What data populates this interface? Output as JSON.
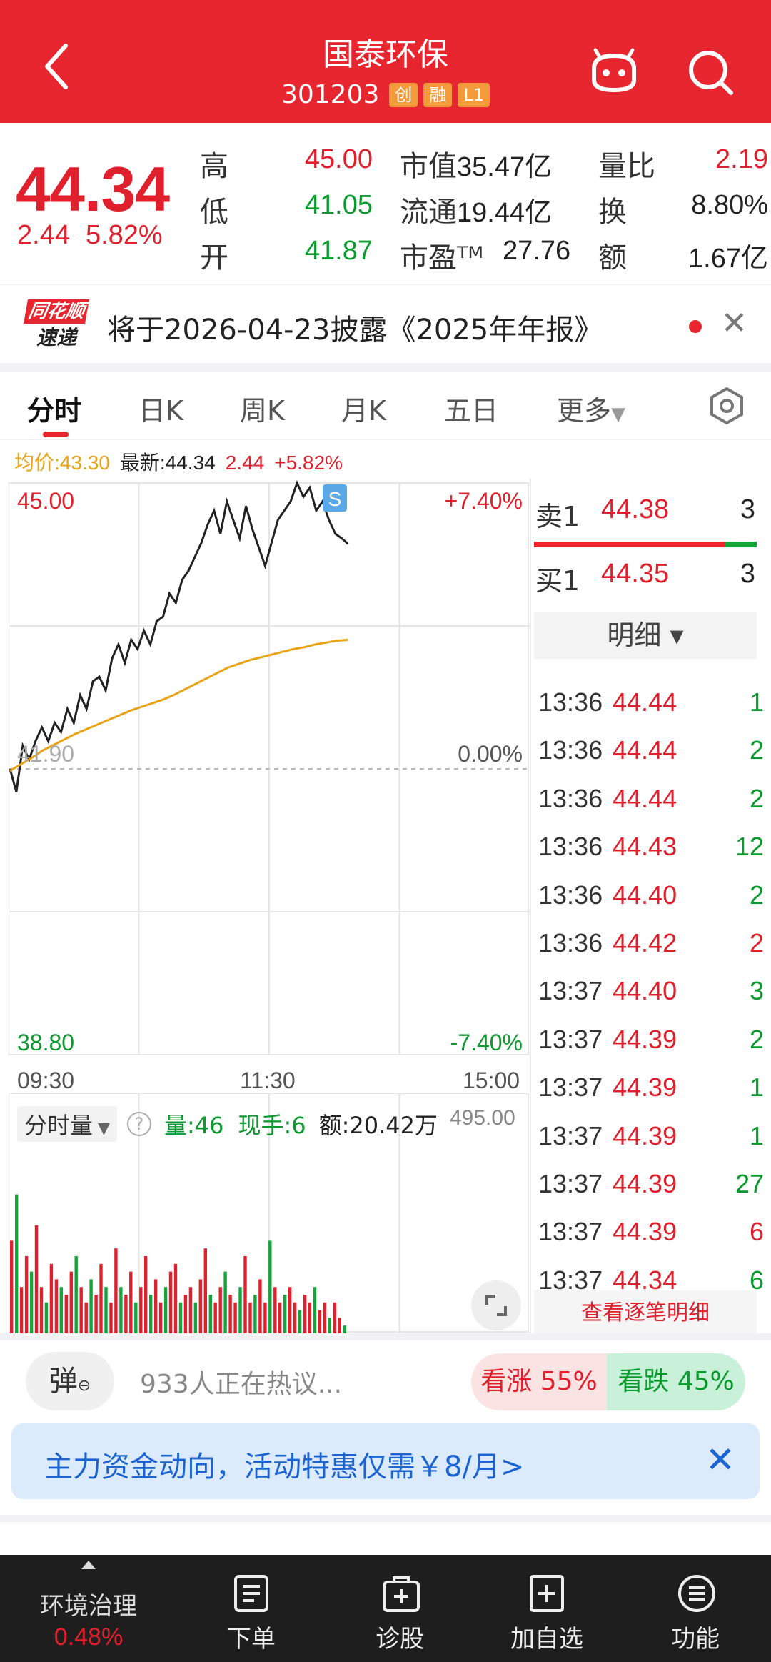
{
  "header": {
    "title": "国泰环保",
    "code": "301203",
    "tags": [
      "创",
      "融",
      "L1"
    ]
  },
  "quote": {
    "price": "44.34",
    "change": "2.44",
    "change_pct": "5.82%",
    "high_label": "高",
    "high": "45.00",
    "low_label": "低",
    "low": "41.05",
    "open_label": "开",
    "open": "41.87",
    "mktcap_label": "市值",
    "mktcap": "35.47亿",
    "float_label": "流通",
    "float": "19.44亿",
    "pe_label": "市盈ᵀᴹ",
    "pe": "27.76",
    "volratio_label": "量比",
    "volratio": "2.19",
    "turnover_label": "换",
    "turnover": "8.80%",
    "amount_label": "额",
    "amount": "1.67亿"
  },
  "notice": {
    "logo_top": "同花顺",
    "logo_bottom": "速递",
    "text": "将于2026-04-23披露《2025年年报》"
  },
  "tabs": [
    "分时",
    "日K",
    "周K",
    "月K",
    "五日",
    "更多"
  ],
  "info": {
    "avg_label": "均价:43.30",
    "latest_label": "最新:44.34",
    "change": "2.44",
    "change_pct": "+5.82%"
  },
  "chart_data": {
    "type": "line",
    "title": "",
    "xlabel": "",
    "ylabel": "",
    "x_ticks": [
      "09:30",
      "11:30",
      "15:00"
    ],
    "y_left_ticks": [
      "45.00",
      "41.90",
      "38.80"
    ],
    "y_right_ticks": [
      "+7.40%",
      "0.00%",
      "-7.40%"
    ],
    "ylim": [
      38.8,
      45.0
    ],
    "prev_close": 41.9,
    "series": [
      {
        "color": "#222222",
        "values": [
          41.9,
          41.65,
          42.15,
          42.0,
          42.2,
          42.35,
          42.2,
          42.4,
          42.3,
          42.55,
          42.4,
          42.7,
          42.55,
          42.85,
          42.9,
          42.75,
          43.1,
          43.25,
          43.05,
          43.3,
          43.2,
          43.4,
          43.25,
          43.5,
          43.55,
          43.8,
          43.7,
          43.95,
          44.05,
          44.2,
          44.35,
          44.55,
          44.7,
          44.45,
          44.8,
          44.6,
          44.4,
          44.75,
          44.5,
          44.3,
          44.1,
          44.35,
          44.6,
          44.7,
          44.8,
          45.0,
          44.85,
          44.95,
          44.7,
          44.8,
          44.6,
          44.45,
          44.4,
          44.34
        ],
        "name": ""
      },
      {
        "color": "#e8a317",
        "values": [
          41.88,
          41.95,
          42.02,
          42.1,
          42.16,
          42.22,
          42.28,
          42.33,
          42.38,
          42.43,
          42.48,
          42.53,
          42.57,
          42.61,
          42.65,
          42.7,
          42.76,
          42.82,
          42.88,
          42.94,
          43.0,
          43.04,
          43.08,
          43.11,
          43.14,
          43.17,
          43.2,
          43.22,
          43.25,
          43.27,
          43.29,
          43.3
        ],
        "name": ""
      }
    ]
  },
  "volume": {
    "selector": "分时量",
    "help": "?",
    "vol": "量:46",
    "hand": "现手:6",
    "amount": "额:20.42万",
    "max": "495.00",
    "bars": [
      0.6,
      0.9,
      0.3,
      0.5,
      0.4,
      0.7,
      0.3,
      0.2,
      0.45,
      0.35,
      0.3,
      0.25,
      0.4,
      0.5,
      0.3,
      0.2,
      0.35,
      0.25,
      0.45,
      0.3,
      0.2,
      0.55,
      0.3,
      0.25,
      0.4,
      0.2,
      0.3,
      0.5,
      0.25,
      0.35,
      0.2,
      0.3,
      0.4,
      0.45,
      0.2,
      0.25,
      0.3,
      0.2,
      0.35,
      0.55,
      0.25,
      0.2,
      0.3,
      0.4,
      0.25,
      0.2,
      0.3,
      0.5,
      0.2,
      0.25,
      0.35,
      0.2,
      0.6,
      0.3,
      0.2,
      0.25,
      0.3,
      0.2,
      0.15,
      0.25,
      0.2,
      0.3,
      0.15,
      0.2,
      0.1,
      0.2,
      0.1,
      0.05
    ]
  },
  "order_book": {
    "sell_label": "卖1",
    "sell_price": "44.38",
    "sell_vol": "3",
    "buy_label": "买1",
    "buy_price": "44.35",
    "buy_vol": "3",
    "detail_label": "明细 ▾",
    "ticks": [
      {
        "time": "13:36",
        "price": "44.44",
        "vol": "1",
        "dir": "green"
      },
      {
        "time": "13:36",
        "price": "44.44",
        "vol": "2",
        "dir": "green"
      },
      {
        "time": "13:36",
        "price": "44.44",
        "vol": "2",
        "dir": "green"
      },
      {
        "time": "13:36",
        "price": "44.43",
        "vol": "12",
        "dir": "green"
      },
      {
        "time": "13:36",
        "price": "44.40",
        "vol": "2",
        "dir": "green"
      },
      {
        "time": "13:36",
        "price": "44.42",
        "vol": "2",
        "dir": "red"
      },
      {
        "time": "13:37",
        "price": "44.40",
        "vol": "3",
        "dir": "green"
      },
      {
        "time": "13:37",
        "price": "44.39",
        "vol": "2",
        "dir": "green"
      },
      {
        "time": "13:37",
        "price": "44.39",
        "vol": "1",
        "dir": "green"
      },
      {
        "time": "13:37",
        "price": "44.39",
        "vol": "1",
        "dir": "green"
      },
      {
        "time": "13:37",
        "price": "44.39",
        "vol": "27",
        "dir": "green"
      },
      {
        "time": "13:37",
        "price": "44.39",
        "vol": "6",
        "dir": "red"
      },
      {
        "time": "13:37",
        "price": "44.34",
        "vol": "6",
        "dir": "green"
      }
    ],
    "all_ticks": "查看逐笔明细"
  },
  "discuss": {
    "danmu": "弹",
    "text": "933人正在热议...",
    "bull": "看涨 55%",
    "bear": "看跌 45%",
    "bull_pct": 55
  },
  "promo": {
    "text": "主力资金动向，活动特惠仅需￥8/月>"
  },
  "bottom_nav": {
    "sector": "环境治理",
    "sector_pct": "0.48%",
    "items": [
      "下单",
      "诊股",
      "加自选",
      "功能"
    ]
  },
  "colors": {
    "brand_red": "#e8262f",
    "up": "#e0202c",
    "down": "#0a9a2e",
    "avg_line": "#e8a317"
  }
}
